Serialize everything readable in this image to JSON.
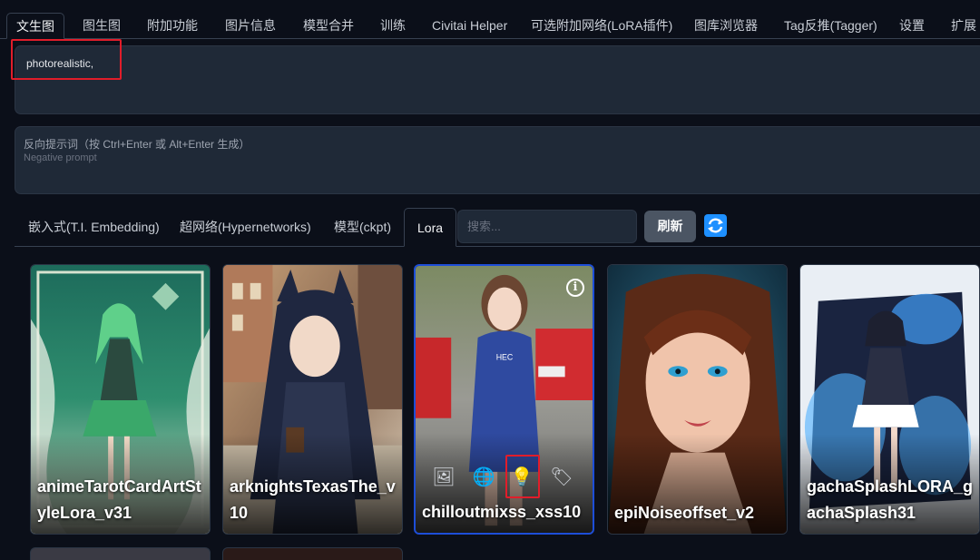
{
  "top_tabs": [
    {
      "label": "文生图",
      "active": true
    },
    {
      "label": "图生图"
    },
    {
      "label": "附加功能"
    },
    {
      "label": "图片信息"
    },
    {
      "label": "模型合并"
    },
    {
      "label": "训练"
    },
    {
      "label": "Civitai Helper"
    },
    {
      "label": "可选附加网络(LoRA插件)"
    },
    {
      "label": "图库浏览器"
    },
    {
      "label": "Tag反推(Tagger)"
    },
    {
      "label": "设置"
    },
    {
      "label": "扩展"
    }
  ],
  "prompt": {
    "value": "photorealistic,"
  },
  "negative_prompt": {
    "label": "反向提示词（按 Ctrl+Enter 或 Alt+Enter 生成）",
    "placeholder": "Negative prompt"
  },
  "network_tabs": [
    {
      "label": "嵌入式(T.I. Embedding)"
    },
    {
      "label": "超网络(Hypernetworks)"
    },
    {
      "label": "模型(ckpt)"
    },
    {
      "label": "Lora",
      "active": true
    }
  ],
  "search": {
    "placeholder": "搜索..."
  },
  "refresh_label": "刷新",
  "cards": [
    {
      "name": "animeTarotCardArtStyleLora_v31"
    },
    {
      "name": "arknightsTexasThe_v10"
    },
    {
      "name": "chilloutmixss_xss10",
      "selected": true
    },
    {
      "name": "epiNoiseoffset_v2"
    },
    {
      "name": "gachaSplashLORA_gachaSplash31"
    }
  ],
  "card_action_icons": [
    "image-icon",
    "globe-icon",
    "lightbulb-icon",
    "tag-icon"
  ],
  "colors": {
    "background": "#0b0f19",
    "panel": "#1f2937",
    "highlight_red": "#e11d2a",
    "selected_border": "#1d4ed8",
    "sync_blue": "#1e90ff"
  }
}
